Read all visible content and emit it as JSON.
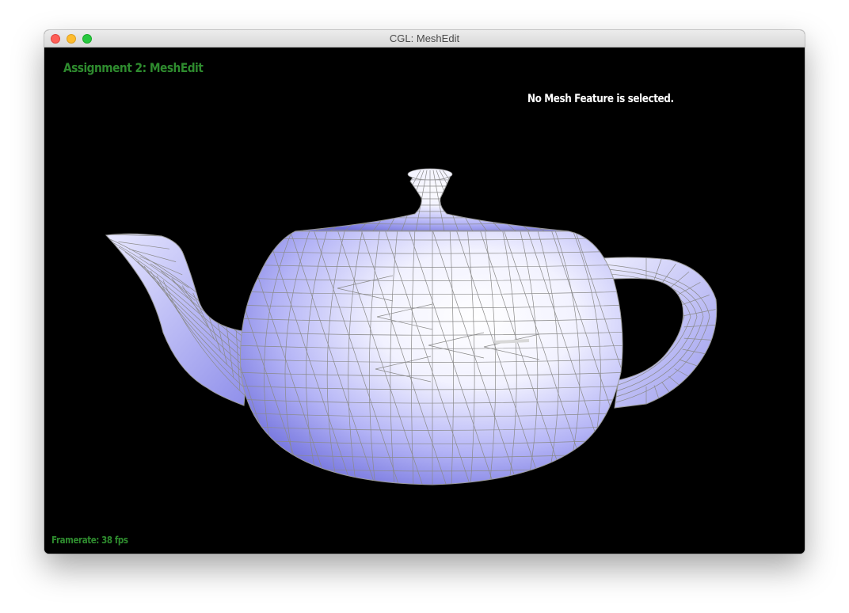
{
  "window": {
    "title": "CGL: MeshEdit"
  },
  "hud": {
    "assignment_title": "Assignment 2: MeshEdit",
    "selection_status": "No Mesh Feature is selected.",
    "framerate_label": "Framerate: 38 fps"
  },
  "scene": {
    "model": "teapot",
    "render_mode": "shaded-with-wireframe",
    "colors": {
      "background": "#000000",
      "mesh_light": "#ffffff",
      "mesh_mid": "#c9c9ff",
      "mesh_dark": "#7a7ae6",
      "wireframe": "#8a8a8a",
      "hud_green": "#2e8b2e",
      "hud_white": "#ffffff"
    }
  }
}
